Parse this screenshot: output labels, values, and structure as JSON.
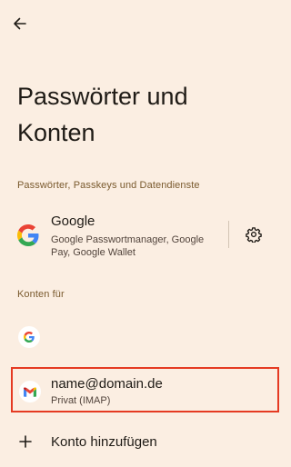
{
  "header": {
    "back_icon": "arrow-back-icon",
    "title": "Passwörter und Konten"
  },
  "sections": {
    "passwords_header": "Passwörter, Passkeys und Datendienste",
    "accounts_header": "Konten für"
  },
  "provider": {
    "name": "Google",
    "description": "Google Passwortmanager, Google Pay, Google Wallet",
    "icon": "google-logo-icon",
    "settings_icon": "gear-icon"
  },
  "accounts": {
    "google_icon": "google-logo-icon",
    "gmail": {
      "email": "name@domain.de",
      "type": "Privat (IMAP)",
      "icon": "gmail-icon",
      "highlight_color": "#e53a22"
    }
  },
  "add_account": {
    "label": "Konto hinzufügen",
    "icon": "plus-icon"
  },
  "colors": {
    "background": "#fbeee2",
    "section_header": "#7a5a2e",
    "highlight_border": "#e53a22"
  }
}
